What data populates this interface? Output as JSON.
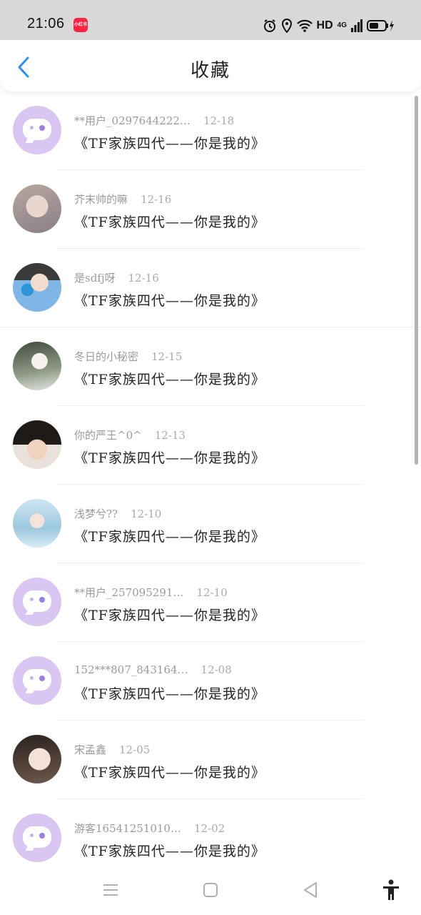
{
  "status_bar": {
    "time": "21:06",
    "app_badge": "小红书",
    "network_hd": "HD",
    "network_gen": "4G"
  },
  "header": {
    "title": "收藏",
    "back_icon": "chevron-left-icon",
    "accent_color": "#2f8fe8"
  },
  "items": [
    {
      "user": "**用户_0297644222…",
      "date": "12-18",
      "content": "《TF家族四代——你是我的》",
      "avatar": "default"
    },
    {
      "user": "芥末帅的嘛",
      "date": "12-16",
      "content": "《TF家族四代——你是我的》",
      "avatar": "photo"
    },
    {
      "user": "是sdfj呀",
      "date": "12-16",
      "content": "《TF家族四代——你是我的》",
      "avatar": "photo"
    },
    {
      "user": "冬日的小秘密",
      "date": "12-15",
      "content": "《TF家族四代——你是我的》",
      "avatar": "photo"
    },
    {
      "user": "你的严王^0^",
      "date": "12-13",
      "content": "《TF家族四代——你是我的》",
      "avatar": "photo"
    },
    {
      "user": "浅梦兮??",
      "date": "12-10",
      "content": "《TF家族四代——你是我的》",
      "avatar": "photo"
    },
    {
      "user": "**用户_257095291…",
      "date": "12-10",
      "content": "《TF家族四代——你是我的》",
      "avatar": "default"
    },
    {
      "user": "152***807_843164…",
      "date": "12-08",
      "content": "《TF家族四代——你是我的》",
      "avatar": "default"
    },
    {
      "user": "宋孟鑫",
      "date": "12-05",
      "content": "《TF家族四代——你是我的》",
      "avatar": "photo"
    },
    {
      "user": "游客16541251010…",
      "date": "12-02",
      "content": "《TF家族四代——你是我的》",
      "avatar": "default"
    }
  ],
  "nav": {
    "menu_icon": "menu-icon",
    "home_icon": "home-square-icon",
    "back_icon": "back-triangle-icon",
    "accessibility_icon": "accessibility-icon"
  }
}
